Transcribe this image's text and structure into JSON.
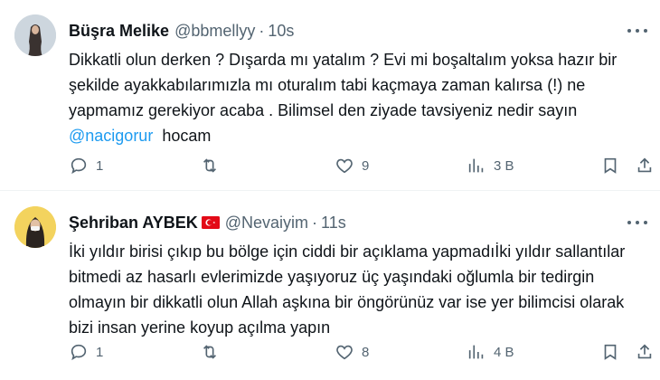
{
  "tweets": [
    {
      "author": "Büşra Melike",
      "handle": "@bbmellyy",
      "separator": "·",
      "time": "10s",
      "text_before": "Dikkatli olun derken ? Dışarda mı yatalım ? Evi mi boşaltalım yoksa hazır bir şekilde ayakkabılarımızla mı oturalım tabi kaçmaya zaman kalırsa (!) ne yapmamız gerekiyor acaba . Bilimsel den ziyade tavsiyeniz nedir sayın\n",
      "mention": "@nacigorur",
      "text_after": "  hocam",
      "actions": {
        "replies": "1",
        "reposts": "",
        "likes": "9",
        "views": "3 B"
      }
    },
    {
      "author": "Şehriban AYBEK",
      "handle": "@Nevaiyim",
      "separator": "·",
      "time": "11s",
      "text": "İki yıldır birisi çıkıp bu bölge için ciddi bir açıklama yapmadıİki yıldır sallantılar bitmedi az hasarlı evlerimizde yaşıyoruz üç yaşındaki oğlumla bir tedirgin olmayın bir dikkatli olun Allah aşkına bir öngörünüz var ise yer bilimcisi olarak bizi insan yerine koyup açılma yapın",
      "actions": {
        "replies": "1",
        "reposts": "",
        "likes": "8",
        "views": "4 B"
      }
    }
  ],
  "icons": [
    "reply-icon",
    "repost-icon",
    "like-icon",
    "views-icon",
    "bookmark-icon",
    "share-icon",
    "more-icon",
    "turkey-flag-icon"
  ],
  "colors": {
    "link": "#1d9bf0",
    "secondary": "#536471",
    "text": "#0f1419",
    "divider": "#eff3f4"
  }
}
